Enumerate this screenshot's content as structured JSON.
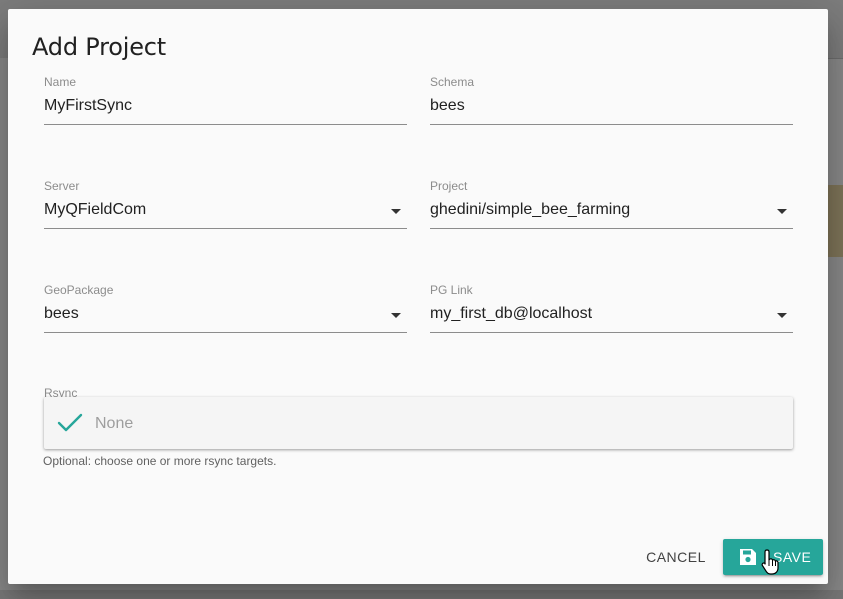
{
  "dialog": {
    "title": "Add Project",
    "fields": {
      "name": {
        "label": "Name",
        "value": "MyFirstSync"
      },
      "schema": {
        "label": "Schema",
        "value": "bees"
      },
      "server": {
        "label": "Server",
        "value": "MyQFieldCom"
      },
      "project": {
        "label": "Project",
        "value": "ghedini/simple_bee_farming"
      },
      "geopackage": {
        "label": "GeoPackage",
        "value": "bees"
      },
      "pglink": {
        "label": "PG Link",
        "value": "my_first_db@localhost"
      }
    },
    "rsync": {
      "label": "Rsync",
      "selected": "None",
      "hint": "Optional: choose one or more rsync targets."
    },
    "actions": {
      "cancel_label": "CANCEL",
      "save_label": "SAVE"
    }
  },
  "colors": {
    "accent": "#26a69a",
    "dialog_bg": "#fafafa",
    "overlay": "#8a8a8a"
  },
  "icons": {
    "check": "check-icon",
    "save": "floppy-disk-icon",
    "dropdown": "arrow-drop-down-icon",
    "cursor": "hand-pointer-cursor"
  }
}
